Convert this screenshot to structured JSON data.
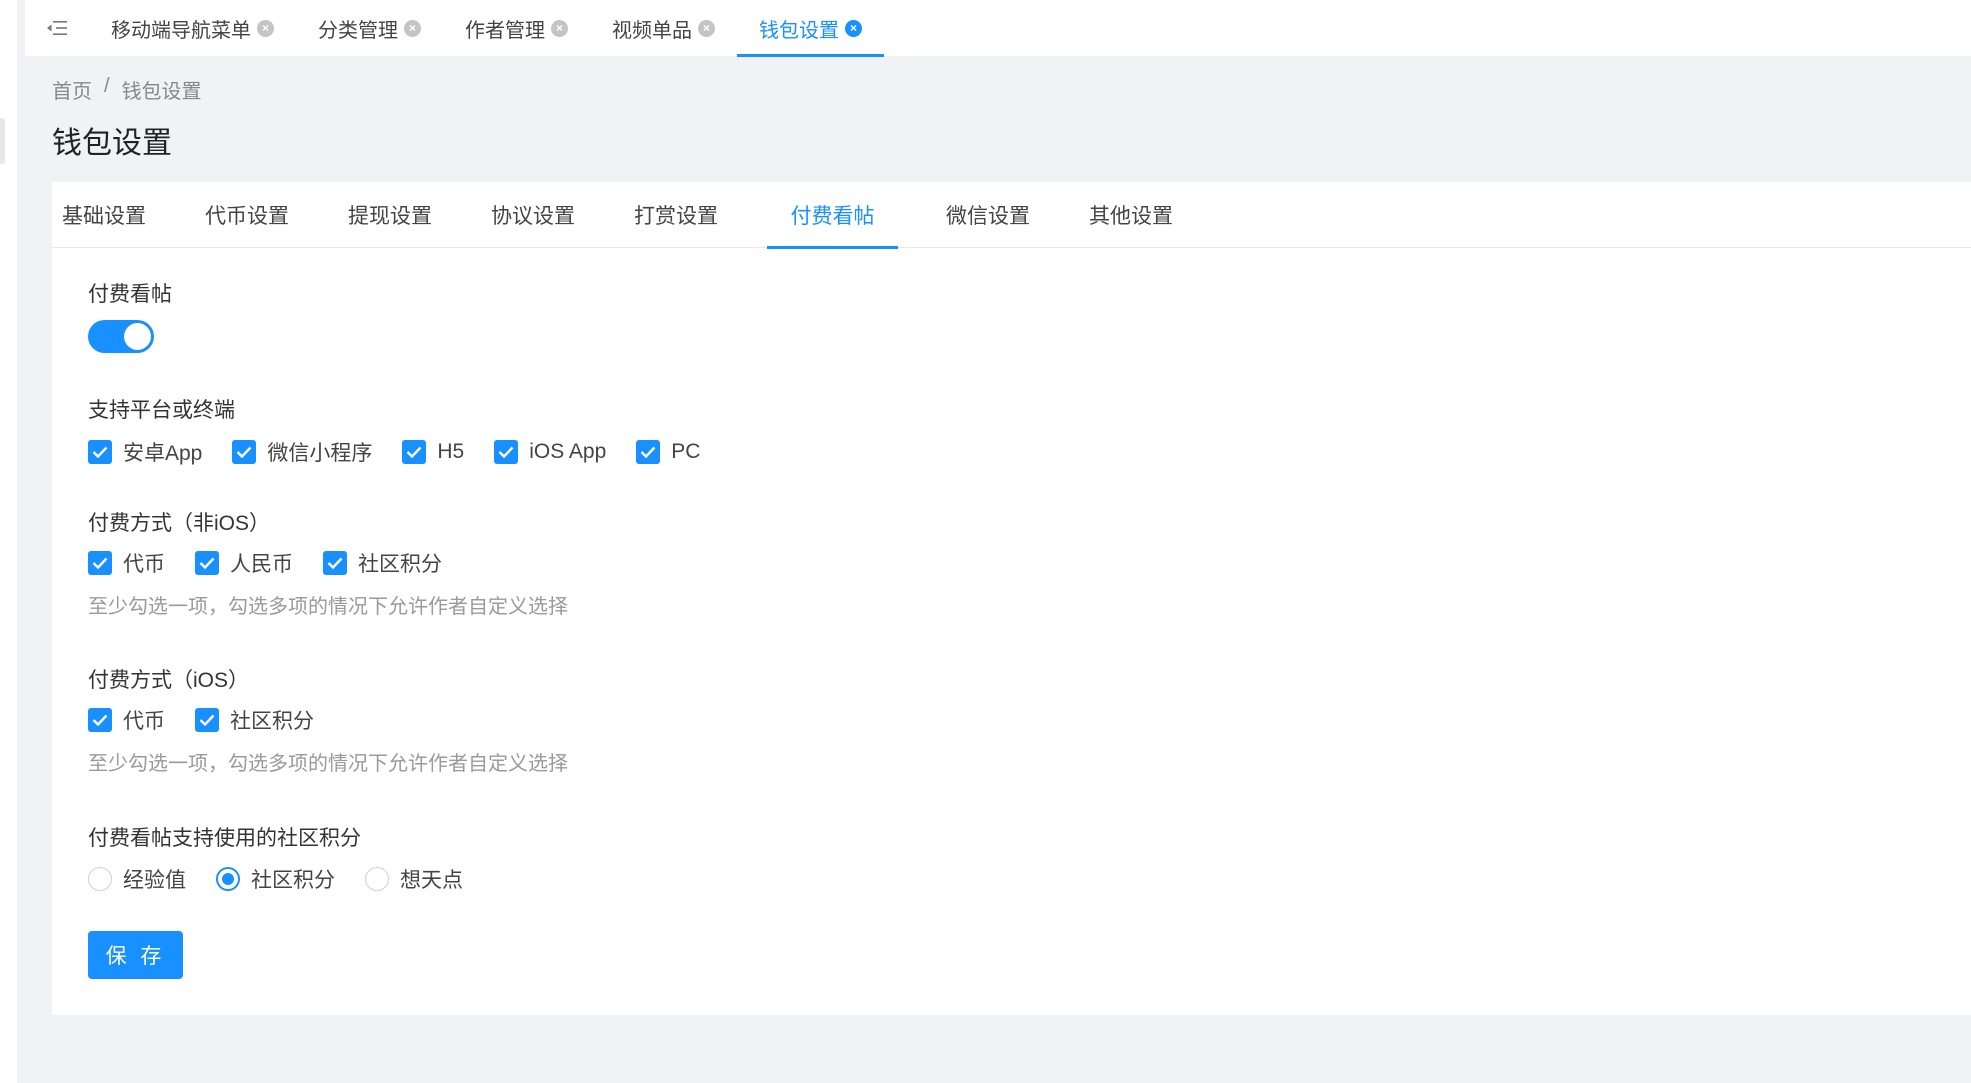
{
  "tabbar": {
    "tabs": [
      {
        "label": "移动端导航菜单",
        "active": false
      },
      {
        "label": "分类管理",
        "active": false
      },
      {
        "label": "作者管理",
        "active": false
      },
      {
        "label": "视频单品",
        "active": false
      },
      {
        "label": "钱包设置",
        "active": true
      }
    ]
  },
  "breadcrumb": {
    "home": "首页",
    "separator": "/",
    "current": "钱包设置"
  },
  "page_title": "钱包设置",
  "settings_tabs": [
    {
      "label": "基础设置",
      "active": false
    },
    {
      "label": "代币设置",
      "active": false
    },
    {
      "label": "提现设置",
      "active": false
    },
    {
      "label": "协议设置",
      "active": false
    },
    {
      "label": "打赏设置",
      "active": false
    },
    {
      "label": "付费看帖",
      "active": true
    },
    {
      "label": "微信设置",
      "active": false
    },
    {
      "label": "其他设置",
      "active": false
    }
  ],
  "form": {
    "paid_view": {
      "label": "付费看帖",
      "enabled": true
    },
    "platforms": {
      "label": "支持平台或终端",
      "options": [
        {
          "label": "安卓App",
          "checked": true
        },
        {
          "label": "微信小程序",
          "checked": true
        },
        {
          "label": "H5",
          "checked": true
        },
        {
          "label": "iOS App",
          "checked": true
        },
        {
          "label": "PC",
          "checked": true
        }
      ]
    },
    "pay_non_ios": {
      "label": "付费方式（非iOS）",
      "options": [
        {
          "label": "代币",
          "checked": true
        },
        {
          "label": "人民币",
          "checked": true
        },
        {
          "label": "社区积分",
          "checked": true
        }
      ],
      "help": "至少勾选一项，勾选多项的情况下允许作者自定义选择"
    },
    "pay_ios": {
      "label": "付费方式（iOS）",
      "options": [
        {
          "label": "代币",
          "checked": true
        },
        {
          "label": "社区积分",
          "checked": true
        }
      ],
      "help": "至少勾选一项，勾选多项的情况下允许作者自定义选择"
    },
    "points_type": {
      "label": "付费看帖支持使用的社区积分",
      "options": [
        {
          "label": "经验值",
          "checked": false
        },
        {
          "label": "社区积分",
          "checked": true
        },
        {
          "label": "想天点",
          "checked": false
        }
      ]
    },
    "save_label": "保 存"
  },
  "colors": {
    "accent": "#1890ff",
    "background": "#f0f2f5"
  }
}
